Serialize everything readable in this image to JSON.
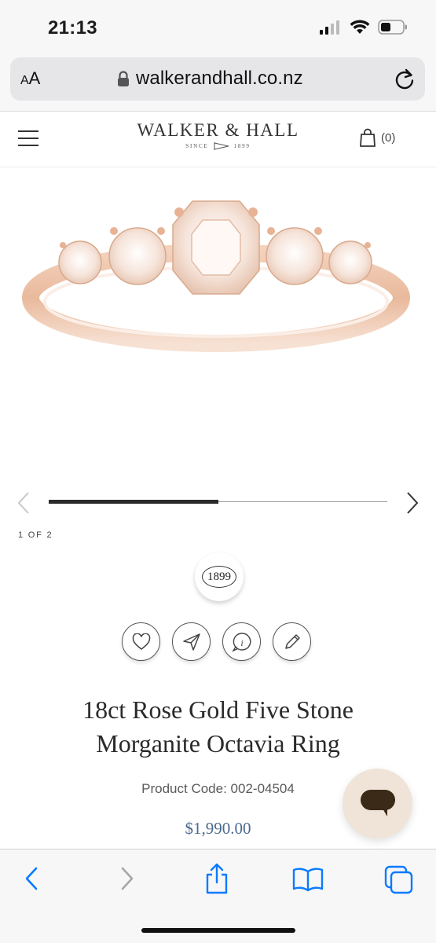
{
  "status_bar": {
    "time": "21:13",
    "signal_icon": "cellular-signal-icon",
    "wifi_icon": "wifi-icon",
    "battery_icon": "battery-icon"
  },
  "browser": {
    "text_size_label_small": "A",
    "text_size_label_large": "A",
    "url": "walkerandhall.co.nz",
    "lock_icon": "lock-icon",
    "reload_icon": "reload-icon"
  },
  "site_header": {
    "menu_icon": "hamburger-menu-icon",
    "logo_title": "WALKER & HALL",
    "logo_since": "SINCE",
    "logo_year": "1899",
    "cart_count": "(0)",
    "cart_icon": "shopping-bag-icon"
  },
  "carousel": {
    "page_indicator": "1 OF 2",
    "progress": 0.5,
    "prev_icon": "chevron-left-icon",
    "next_icon": "chevron-right-icon"
  },
  "badge": {
    "label": "1899"
  },
  "actions": [
    {
      "name": "wishlist-button",
      "icon": "heart-icon"
    },
    {
      "name": "share-button",
      "icon": "send-icon"
    },
    {
      "name": "info-button",
      "icon": "info-icon"
    },
    {
      "name": "edit-button",
      "icon": "pencil-icon"
    }
  ],
  "product": {
    "title_line1": "18ct Rose Gold Five Stone",
    "title_line2": "Morganite Octavia Ring",
    "code": "Product Code: 002-04504",
    "price": "$1,990.00"
  },
  "chat": {
    "icon": "chat-bubble-icon"
  },
  "toolbar": {
    "back_icon": "back-icon",
    "forward_icon": "forward-icon",
    "share_icon": "share-icon",
    "bookmarks_icon": "book-icon",
    "tabs_icon": "tabs-icon"
  },
  "colors": {
    "accent_price": "#4c6a8f",
    "chat_bg": "#efe4d7",
    "ios_blue": "#0a7aff"
  }
}
